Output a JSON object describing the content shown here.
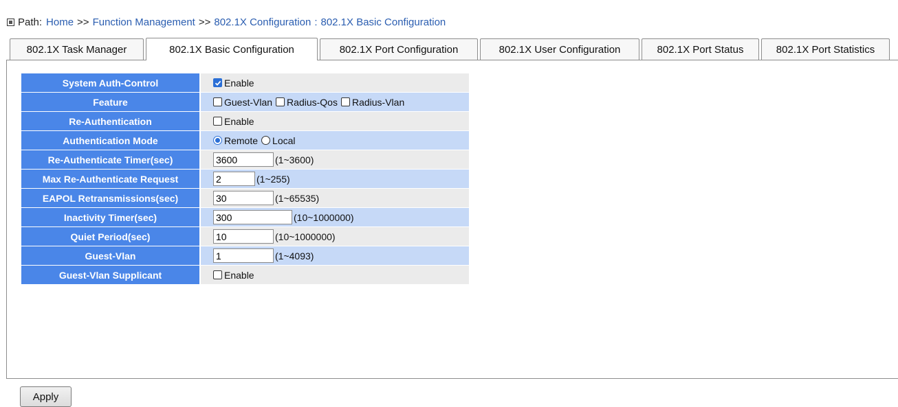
{
  "path": {
    "label": "Path:",
    "crumbs": [
      "Home",
      "Function Management",
      "802.1X Configuration"
    ],
    "sep": ">>",
    "sep_last": ":",
    "current": "802.1X Basic Configuration"
  },
  "tabs": [
    {
      "label": "802.1X Task Manager",
      "active": false
    },
    {
      "label": "802.1X Basic Configuration",
      "active": true
    },
    {
      "label": "802.1X Port Configuration",
      "active": false
    },
    {
      "label": "802.1X User Configuration",
      "active": false
    },
    {
      "label": "802.1X Port Status",
      "active": false
    },
    {
      "label": "802.1X Port Statistics",
      "active": false
    }
  ],
  "form": {
    "system_auth_control": {
      "label": "System Auth-Control",
      "option": "Enable",
      "checked": true
    },
    "feature": {
      "label": "Feature",
      "options": [
        {
          "label": "Guest-Vlan",
          "checked": false
        },
        {
          "label": "Radius-Qos",
          "checked": false
        },
        {
          "label": "Radius-Vlan",
          "checked": false
        }
      ]
    },
    "re_authentication": {
      "label": "Re-Authentication",
      "option": "Enable",
      "checked": false
    },
    "authentication_mode": {
      "label": "Authentication Mode",
      "options": [
        {
          "label": "Remote",
          "selected": true
        },
        {
          "label": "Local",
          "selected": false
        }
      ]
    },
    "re_auth_timer": {
      "label": "Re-Authenticate Timer(sec)",
      "value": "3600",
      "range": "(1~3600)"
    },
    "max_re_auth_request": {
      "label": "Max Re-Authenticate Request",
      "value": "2",
      "range": "(1~255)"
    },
    "eapol_retrans": {
      "label": "EAPOL Retransmissions(sec)",
      "value": "30",
      "range": "(1~65535)"
    },
    "inactivity_timer": {
      "label": "Inactivity Timer(sec)",
      "value": "300",
      "range": "(10~1000000)"
    },
    "quiet_period": {
      "label": "Quiet Period(sec)",
      "value": "10",
      "range": "(10~1000000)"
    },
    "guest_vlan": {
      "label": "Guest-Vlan",
      "value": "1",
      "range": "(1~4093)"
    },
    "guest_vlan_supplicant": {
      "label": "Guest-Vlan Supplicant",
      "option": "Enable",
      "checked": false
    }
  },
  "apply_label": "Apply",
  "colors": {
    "label_bg": "#4a86e8",
    "row_odd": "#ebebeb",
    "row_even": "#c6d9f7",
    "link": "#2a5db0"
  }
}
